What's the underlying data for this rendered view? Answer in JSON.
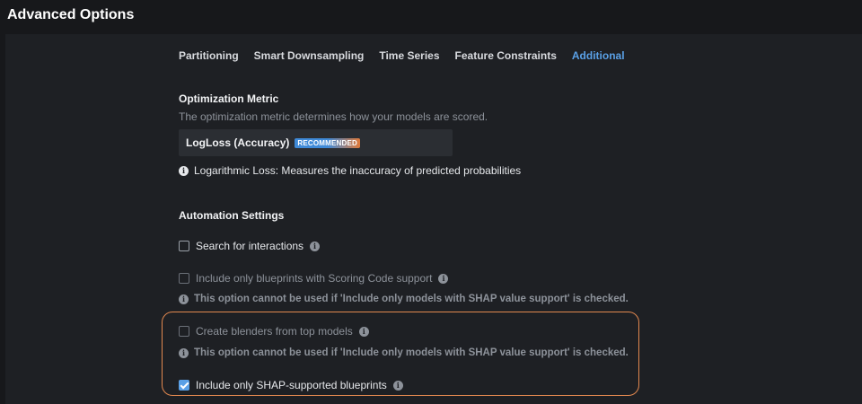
{
  "header": {
    "title": "Advanced Options"
  },
  "tabs": [
    {
      "label": "Partitioning",
      "active": false
    },
    {
      "label": "Smart Downsampling",
      "active": false
    },
    {
      "label": "Time Series",
      "active": false
    },
    {
      "label": "Feature Constraints",
      "active": false
    },
    {
      "label": "Additional",
      "active": true
    }
  ],
  "optimization": {
    "title": "Optimization Metric",
    "description": "The optimization metric determines how your models are scored.",
    "selected_value": "LogLoss (Accuracy)",
    "badge": "RECOMMENDED",
    "info": "Logarithmic Loss: Measures the inaccuracy of predicted probabilities"
  },
  "automation": {
    "title": "Automation Settings",
    "search_interactions": {
      "label": "Search for interactions",
      "checked": false
    },
    "scoring_code": {
      "label": "Include only blueprints with Scoring Code support",
      "checked": false,
      "warning": "This option cannot be used if 'Include only models with SHAP value support' is checked."
    },
    "blenders": {
      "label": "Create blenders from top models",
      "checked": false,
      "warning": "This option cannot be used if 'Include only models with SHAP value support' is checked."
    },
    "shap": {
      "label": "Include only SHAP-supported blueprints",
      "checked": true
    }
  },
  "icons": {
    "info": "info-icon",
    "check": "checkmark-icon"
  },
  "colors": {
    "accent": "#5aa0e6",
    "highlight": "#e2884f",
    "background": "#1e2024"
  }
}
